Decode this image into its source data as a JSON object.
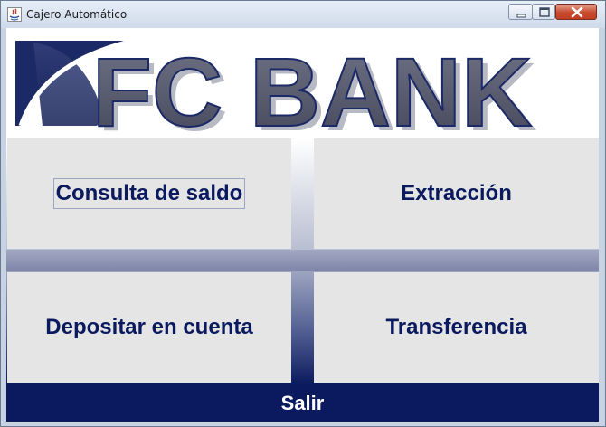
{
  "window": {
    "title": "Cajero Automático",
    "controls": [
      "minimize",
      "maximize",
      "close"
    ]
  },
  "banner": {
    "logo_text": "FC BANK",
    "logo_color": "#1b2a66",
    "logo_secondary_color": "#555a72"
  },
  "menu": {
    "buttons": [
      {
        "label": "Consulta de saldo",
        "focused": true
      },
      {
        "label": "Extracción"
      },
      {
        "label": "Depositar en cuenta"
      },
      {
        "label": "Transferencia"
      }
    ],
    "exit_label": "Salir"
  },
  "colors": {
    "accent": "#0b1a5e",
    "tile_bg": "#e5e5e5",
    "text": "#0b1a5e"
  }
}
